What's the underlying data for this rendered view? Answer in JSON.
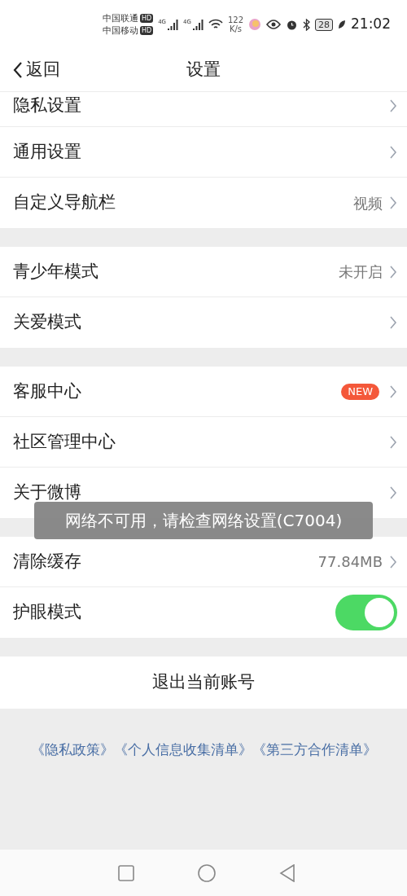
{
  "status_bar": {
    "carriers": [
      "中国联通",
      "中国移动"
    ],
    "network_badges": [
      "HD",
      "HD"
    ],
    "signal_labels": [
      "4G",
      "4G"
    ],
    "speed": [
      "122",
      "K/s"
    ],
    "battery": "28",
    "time": "21:02"
  },
  "header": {
    "back": "返回",
    "title": "设置"
  },
  "groups": [
    {
      "items": [
        {
          "kind": "link",
          "label": "隐私设置",
          "cut": true
        },
        {
          "kind": "link",
          "label": "通用设置"
        },
        {
          "kind": "link",
          "label": "自定义导航栏",
          "value": "视频"
        }
      ]
    },
    {
      "items": [
        {
          "kind": "link",
          "label": "青少年模式",
          "value": "未开启"
        },
        {
          "kind": "link",
          "label": "关爱模式"
        }
      ]
    },
    {
      "items": [
        {
          "kind": "badge",
          "label": "客服中心",
          "badge": "NEW"
        },
        {
          "kind": "link",
          "label": "社区管理中心"
        },
        {
          "kind": "link",
          "label": "关于微博"
        }
      ]
    },
    {
      "items": [
        {
          "kind": "link",
          "label": "清除缓存",
          "value": "77.84MB"
        },
        {
          "kind": "toggle",
          "label": "护眼模式",
          "on": true
        }
      ]
    }
  ],
  "logout": "退出当前账号",
  "policy_links": [
    "《隐私政策》",
    "《个人信息收集清单》",
    "《第三方合作清单》"
  ],
  "toast": "网络不可用，请检查网络设置(C7004)"
}
